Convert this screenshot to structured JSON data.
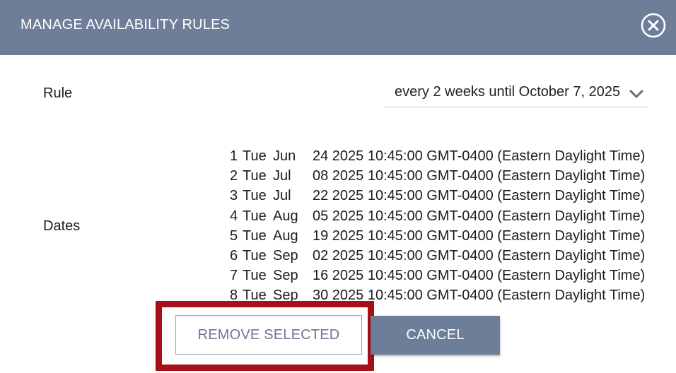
{
  "header": {
    "title": "MANAGE AVAILABILITY RULES"
  },
  "rule": {
    "label": "Rule",
    "value": "every 2 weeks until October 7, 2025"
  },
  "dates": {
    "label": "Dates",
    "items": [
      {
        "num": "1",
        "day": "Tue",
        "month": "Jun",
        "rest": "24 2025 10:45:00 GMT-0400 (Eastern Daylight Time)"
      },
      {
        "num": "2",
        "day": "Tue",
        "month": "Jul",
        "rest": "08 2025 10:45:00 GMT-0400 (Eastern Daylight Time)"
      },
      {
        "num": "3",
        "day": "Tue",
        "month": "Jul",
        "rest": "22 2025 10:45:00 GMT-0400 (Eastern Daylight Time)"
      },
      {
        "num": "4",
        "day": "Tue",
        "month": "Aug",
        "rest": "05 2025 10:45:00 GMT-0400 (Eastern Daylight Time)"
      },
      {
        "num": "5",
        "day": "Tue",
        "month": "Aug",
        "rest": "19 2025 10:45:00 GMT-0400 (Eastern Daylight Time)"
      },
      {
        "num": "6",
        "day": "Tue",
        "month": "Sep",
        "rest": "02 2025 10:45:00 GMT-0400 (Eastern Daylight Time)"
      },
      {
        "num": "7",
        "day": "Tue",
        "month": "Sep",
        "rest": "16 2025 10:45:00 GMT-0400 (Eastern Daylight Time)"
      },
      {
        "num": "8",
        "day": "Tue",
        "month": "Sep",
        "rest": "30 2025 10:45:00 GMT-0400 (Eastern Daylight Time)"
      }
    ]
  },
  "actions": {
    "remove_label": "REMOVE SELECTED",
    "cancel_label": "CANCEL"
  },
  "icons": {
    "close": "close-circle-icon",
    "dropdown": "chevron-down-icon"
  },
  "colors": {
    "header_bg": "#6e7e98",
    "highlight": "#a60f15"
  }
}
